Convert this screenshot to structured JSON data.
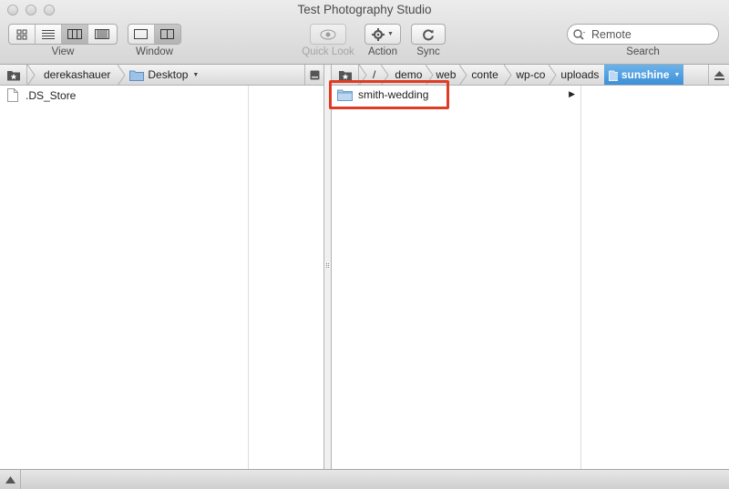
{
  "window": {
    "title": "Test Photography Studio"
  },
  "toolbar": {
    "view_label": "View",
    "window_label": "Window",
    "quicklook_label": "Quick Look",
    "action_label": "Action",
    "sync_label": "Sync",
    "search_label": "Search",
    "search_value": "Remote"
  },
  "left_path": {
    "items": [
      "derekashauer",
      "Desktop"
    ]
  },
  "left_files": [
    {
      "name": ".DS_Store",
      "type": "file"
    }
  ],
  "right_path": {
    "items": [
      "/",
      "demo",
      "web",
      "conte",
      "wp-co",
      "uploads",
      "sunshine"
    ],
    "selected": "sunshine"
  },
  "right_files": [
    {
      "name": "smith-wedding",
      "type": "folder",
      "has_children": true
    }
  ],
  "colors": {
    "highlight": "#e03b24",
    "selected_crumb": "#3d8fd9",
    "folder": "#8fb6dc"
  }
}
